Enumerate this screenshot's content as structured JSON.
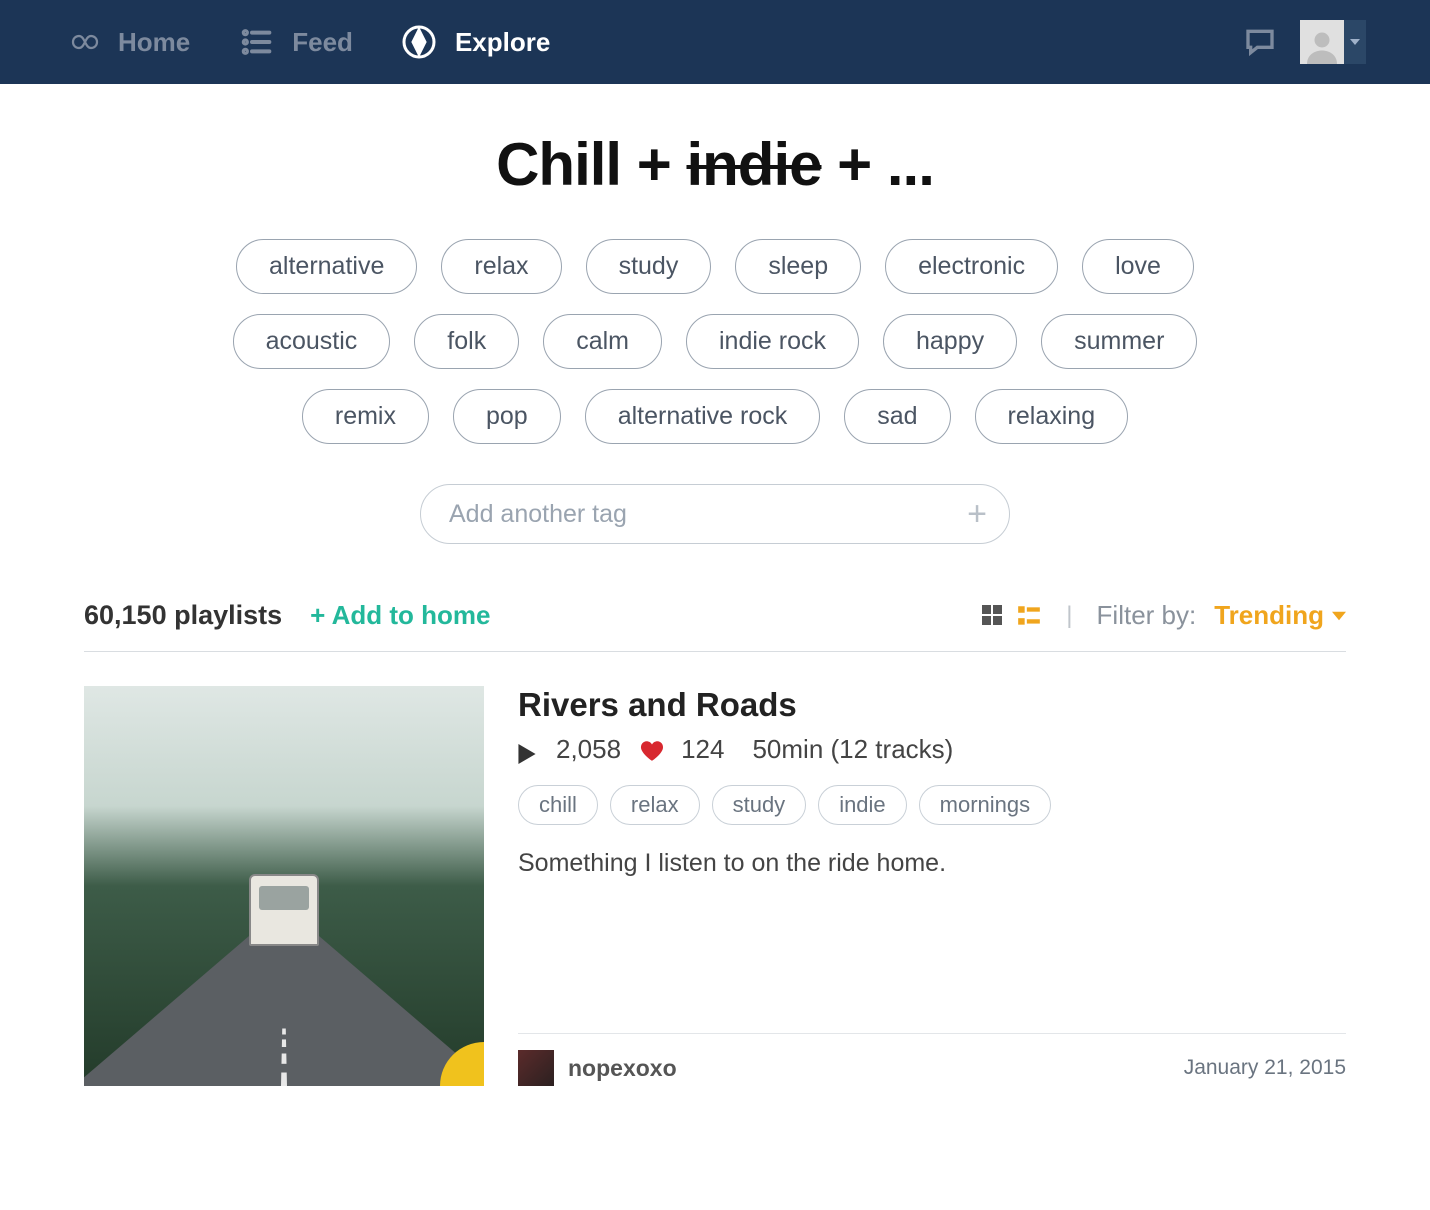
{
  "nav": {
    "home": "Home",
    "feed": "Feed",
    "explore": "Explore"
  },
  "heading": {
    "tag1": "Chill",
    "tag2": "indie",
    "ellipsis": "..."
  },
  "tags": {
    "row1": [
      "alternative",
      "relax",
      "study",
      "sleep",
      "electronic",
      "love"
    ],
    "row2": [
      "acoustic",
      "folk",
      "calm",
      "indie rock",
      "happy",
      "summer"
    ],
    "row3": [
      "remix",
      "pop",
      "alternative rock",
      "sad",
      "relaxing"
    ]
  },
  "add_tag": {
    "placeholder": "Add another tag"
  },
  "results": {
    "count_text": "60,150 playlists",
    "add_home": "+ Add to home",
    "filter_label": "Filter by:",
    "filter_value": "Trending"
  },
  "playlist": {
    "title": "Rivers and Roads",
    "plays": "2,058",
    "likes": "124",
    "duration": "50min (12 tracks)",
    "tags": [
      "chill",
      "relax",
      "study",
      "indie",
      "mornings"
    ],
    "description": "Something I listen to on the ride home.",
    "author": "nopexoxo",
    "date": "January 21, 2015"
  }
}
